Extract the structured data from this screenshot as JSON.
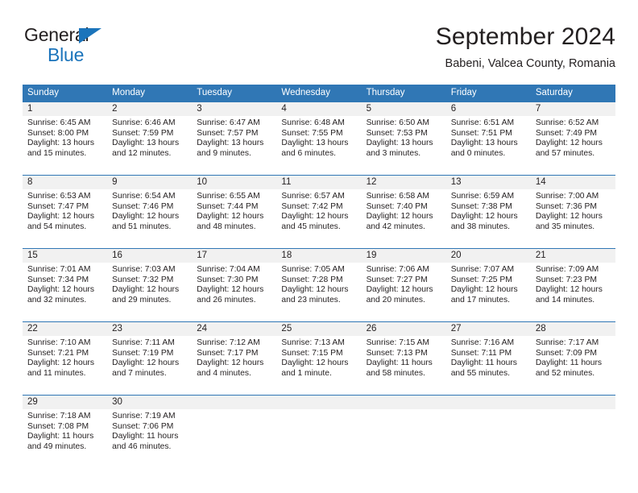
{
  "logo": {
    "word1": "General",
    "word2": "Blue",
    "triangle_color": "#1b74bb"
  },
  "header": {
    "title": "September 2024",
    "subtitle": "Babeni, Valcea County, Romania"
  },
  "theme": {
    "header_blue": "#3077b5",
    "daynum_band": "#f1f1f1",
    "text": "#231f20"
  },
  "weekdays": [
    "Sunday",
    "Monday",
    "Tuesday",
    "Wednesday",
    "Thursday",
    "Friday",
    "Saturday"
  ],
  "weeks": [
    [
      {
        "day": "1",
        "sunrise": "Sunrise: 6:45 AM",
        "sunset": "Sunset: 8:00 PM",
        "daylight1": "Daylight: 13 hours",
        "daylight2": "and 15 minutes."
      },
      {
        "day": "2",
        "sunrise": "Sunrise: 6:46 AM",
        "sunset": "Sunset: 7:59 PM",
        "daylight1": "Daylight: 13 hours",
        "daylight2": "and 12 minutes."
      },
      {
        "day": "3",
        "sunrise": "Sunrise: 6:47 AM",
        "sunset": "Sunset: 7:57 PM",
        "daylight1": "Daylight: 13 hours",
        "daylight2": "and 9 minutes."
      },
      {
        "day": "4",
        "sunrise": "Sunrise: 6:48 AM",
        "sunset": "Sunset: 7:55 PM",
        "daylight1": "Daylight: 13 hours",
        "daylight2": "and 6 minutes."
      },
      {
        "day": "5",
        "sunrise": "Sunrise: 6:50 AM",
        "sunset": "Sunset: 7:53 PM",
        "daylight1": "Daylight: 13 hours",
        "daylight2": "and 3 minutes."
      },
      {
        "day": "6",
        "sunrise": "Sunrise: 6:51 AM",
        "sunset": "Sunset: 7:51 PM",
        "daylight1": "Daylight: 13 hours",
        "daylight2": "and 0 minutes."
      },
      {
        "day": "7",
        "sunrise": "Sunrise: 6:52 AM",
        "sunset": "Sunset: 7:49 PM",
        "daylight1": "Daylight: 12 hours",
        "daylight2": "and 57 minutes."
      }
    ],
    [
      {
        "day": "8",
        "sunrise": "Sunrise: 6:53 AM",
        "sunset": "Sunset: 7:47 PM",
        "daylight1": "Daylight: 12 hours",
        "daylight2": "and 54 minutes."
      },
      {
        "day": "9",
        "sunrise": "Sunrise: 6:54 AM",
        "sunset": "Sunset: 7:46 PM",
        "daylight1": "Daylight: 12 hours",
        "daylight2": "and 51 minutes."
      },
      {
        "day": "10",
        "sunrise": "Sunrise: 6:55 AM",
        "sunset": "Sunset: 7:44 PM",
        "daylight1": "Daylight: 12 hours",
        "daylight2": "and 48 minutes."
      },
      {
        "day": "11",
        "sunrise": "Sunrise: 6:57 AM",
        "sunset": "Sunset: 7:42 PM",
        "daylight1": "Daylight: 12 hours",
        "daylight2": "and 45 minutes."
      },
      {
        "day": "12",
        "sunrise": "Sunrise: 6:58 AM",
        "sunset": "Sunset: 7:40 PM",
        "daylight1": "Daylight: 12 hours",
        "daylight2": "and 42 minutes."
      },
      {
        "day": "13",
        "sunrise": "Sunrise: 6:59 AM",
        "sunset": "Sunset: 7:38 PM",
        "daylight1": "Daylight: 12 hours",
        "daylight2": "and 38 minutes."
      },
      {
        "day": "14",
        "sunrise": "Sunrise: 7:00 AM",
        "sunset": "Sunset: 7:36 PM",
        "daylight1": "Daylight: 12 hours",
        "daylight2": "and 35 minutes."
      }
    ],
    [
      {
        "day": "15",
        "sunrise": "Sunrise: 7:01 AM",
        "sunset": "Sunset: 7:34 PM",
        "daylight1": "Daylight: 12 hours",
        "daylight2": "and 32 minutes."
      },
      {
        "day": "16",
        "sunrise": "Sunrise: 7:03 AM",
        "sunset": "Sunset: 7:32 PM",
        "daylight1": "Daylight: 12 hours",
        "daylight2": "and 29 minutes."
      },
      {
        "day": "17",
        "sunrise": "Sunrise: 7:04 AM",
        "sunset": "Sunset: 7:30 PM",
        "daylight1": "Daylight: 12 hours",
        "daylight2": "and 26 minutes."
      },
      {
        "day": "18",
        "sunrise": "Sunrise: 7:05 AM",
        "sunset": "Sunset: 7:28 PM",
        "daylight1": "Daylight: 12 hours",
        "daylight2": "and 23 minutes."
      },
      {
        "day": "19",
        "sunrise": "Sunrise: 7:06 AM",
        "sunset": "Sunset: 7:27 PM",
        "daylight1": "Daylight: 12 hours",
        "daylight2": "and 20 minutes."
      },
      {
        "day": "20",
        "sunrise": "Sunrise: 7:07 AM",
        "sunset": "Sunset: 7:25 PM",
        "daylight1": "Daylight: 12 hours",
        "daylight2": "and 17 minutes."
      },
      {
        "day": "21",
        "sunrise": "Sunrise: 7:09 AM",
        "sunset": "Sunset: 7:23 PM",
        "daylight1": "Daylight: 12 hours",
        "daylight2": "and 14 minutes."
      }
    ],
    [
      {
        "day": "22",
        "sunrise": "Sunrise: 7:10 AM",
        "sunset": "Sunset: 7:21 PM",
        "daylight1": "Daylight: 12 hours",
        "daylight2": "and 11 minutes."
      },
      {
        "day": "23",
        "sunrise": "Sunrise: 7:11 AM",
        "sunset": "Sunset: 7:19 PM",
        "daylight1": "Daylight: 12 hours",
        "daylight2": "and 7 minutes."
      },
      {
        "day": "24",
        "sunrise": "Sunrise: 7:12 AM",
        "sunset": "Sunset: 7:17 PM",
        "daylight1": "Daylight: 12 hours",
        "daylight2": "and 4 minutes."
      },
      {
        "day": "25",
        "sunrise": "Sunrise: 7:13 AM",
        "sunset": "Sunset: 7:15 PM",
        "daylight1": "Daylight: 12 hours",
        "daylight2": "and 1 minute."
      },
      {
        "day": "26",
        "sunrise": "Sunrise: 7:15 AM",
        "sunset": "Sunset: 7:13 PM",
        "daylight1": "Daylight: 11 hours",
        "daylight2": "and 58 minutes."
      },
      {
        "day": "27",
        "sunrise": "Sunrise: 7:16 AM",
        "sunset": "Sunset: 7:11 PM",
        "daylight1": "Daylight: 11 hours",
        "daylight2": "and 55 minutes."
      },
      {
        "day": "28",
        "sunrise": "Sunrise: 7:17 AM",
        "sunset": "Sunset: 7:09 PM",
        "daylight1": "Daylight: 11 hours",
        "daylight2": "and 52 minutes."
      }
    ],
    [
      {
        "day": "29",
        "sunrise": "Sunrise: 7:18 AM",
        "sunset": "Sunset: 7:08 PM",
        "daylight1": "Daylight: 11 hours",
        "daylight2": "and 49 minutes."
      },
      {
        "day": "30",
        "sunrise": "Sunrise: 7:19 AM",
        "sunset": "Sunset: 7:06 PM",
        "daylight1": "Daylight: 11 hours",
        "daylight2": "and 46 minutes."
      },
      {
        "day": "",
        "sunrise": "",
        "sunset": "",
        "daylight1": "",
        "daylight2": ""
      },
      {
        "day": "",
        "sunrise": "",
        "sunset": "",
        "daylight1": "",
        "daylight2": ""
      },
      {
        "day": "",
        "sunrise": "",
        "sunset": "",
        "daylight1": "",
        "daylight2": ""
      },
      {
        "day": "",
        "sunrise": "",
        "sunset": "",
        "daylight1": "",
        "daylight2": ""
      },
      {
        "day": "",
        "sunrise": "",
        "sunset": "",
        "daylight1": "",
        "daylight2": ""
      }
    ]
  ]
}
